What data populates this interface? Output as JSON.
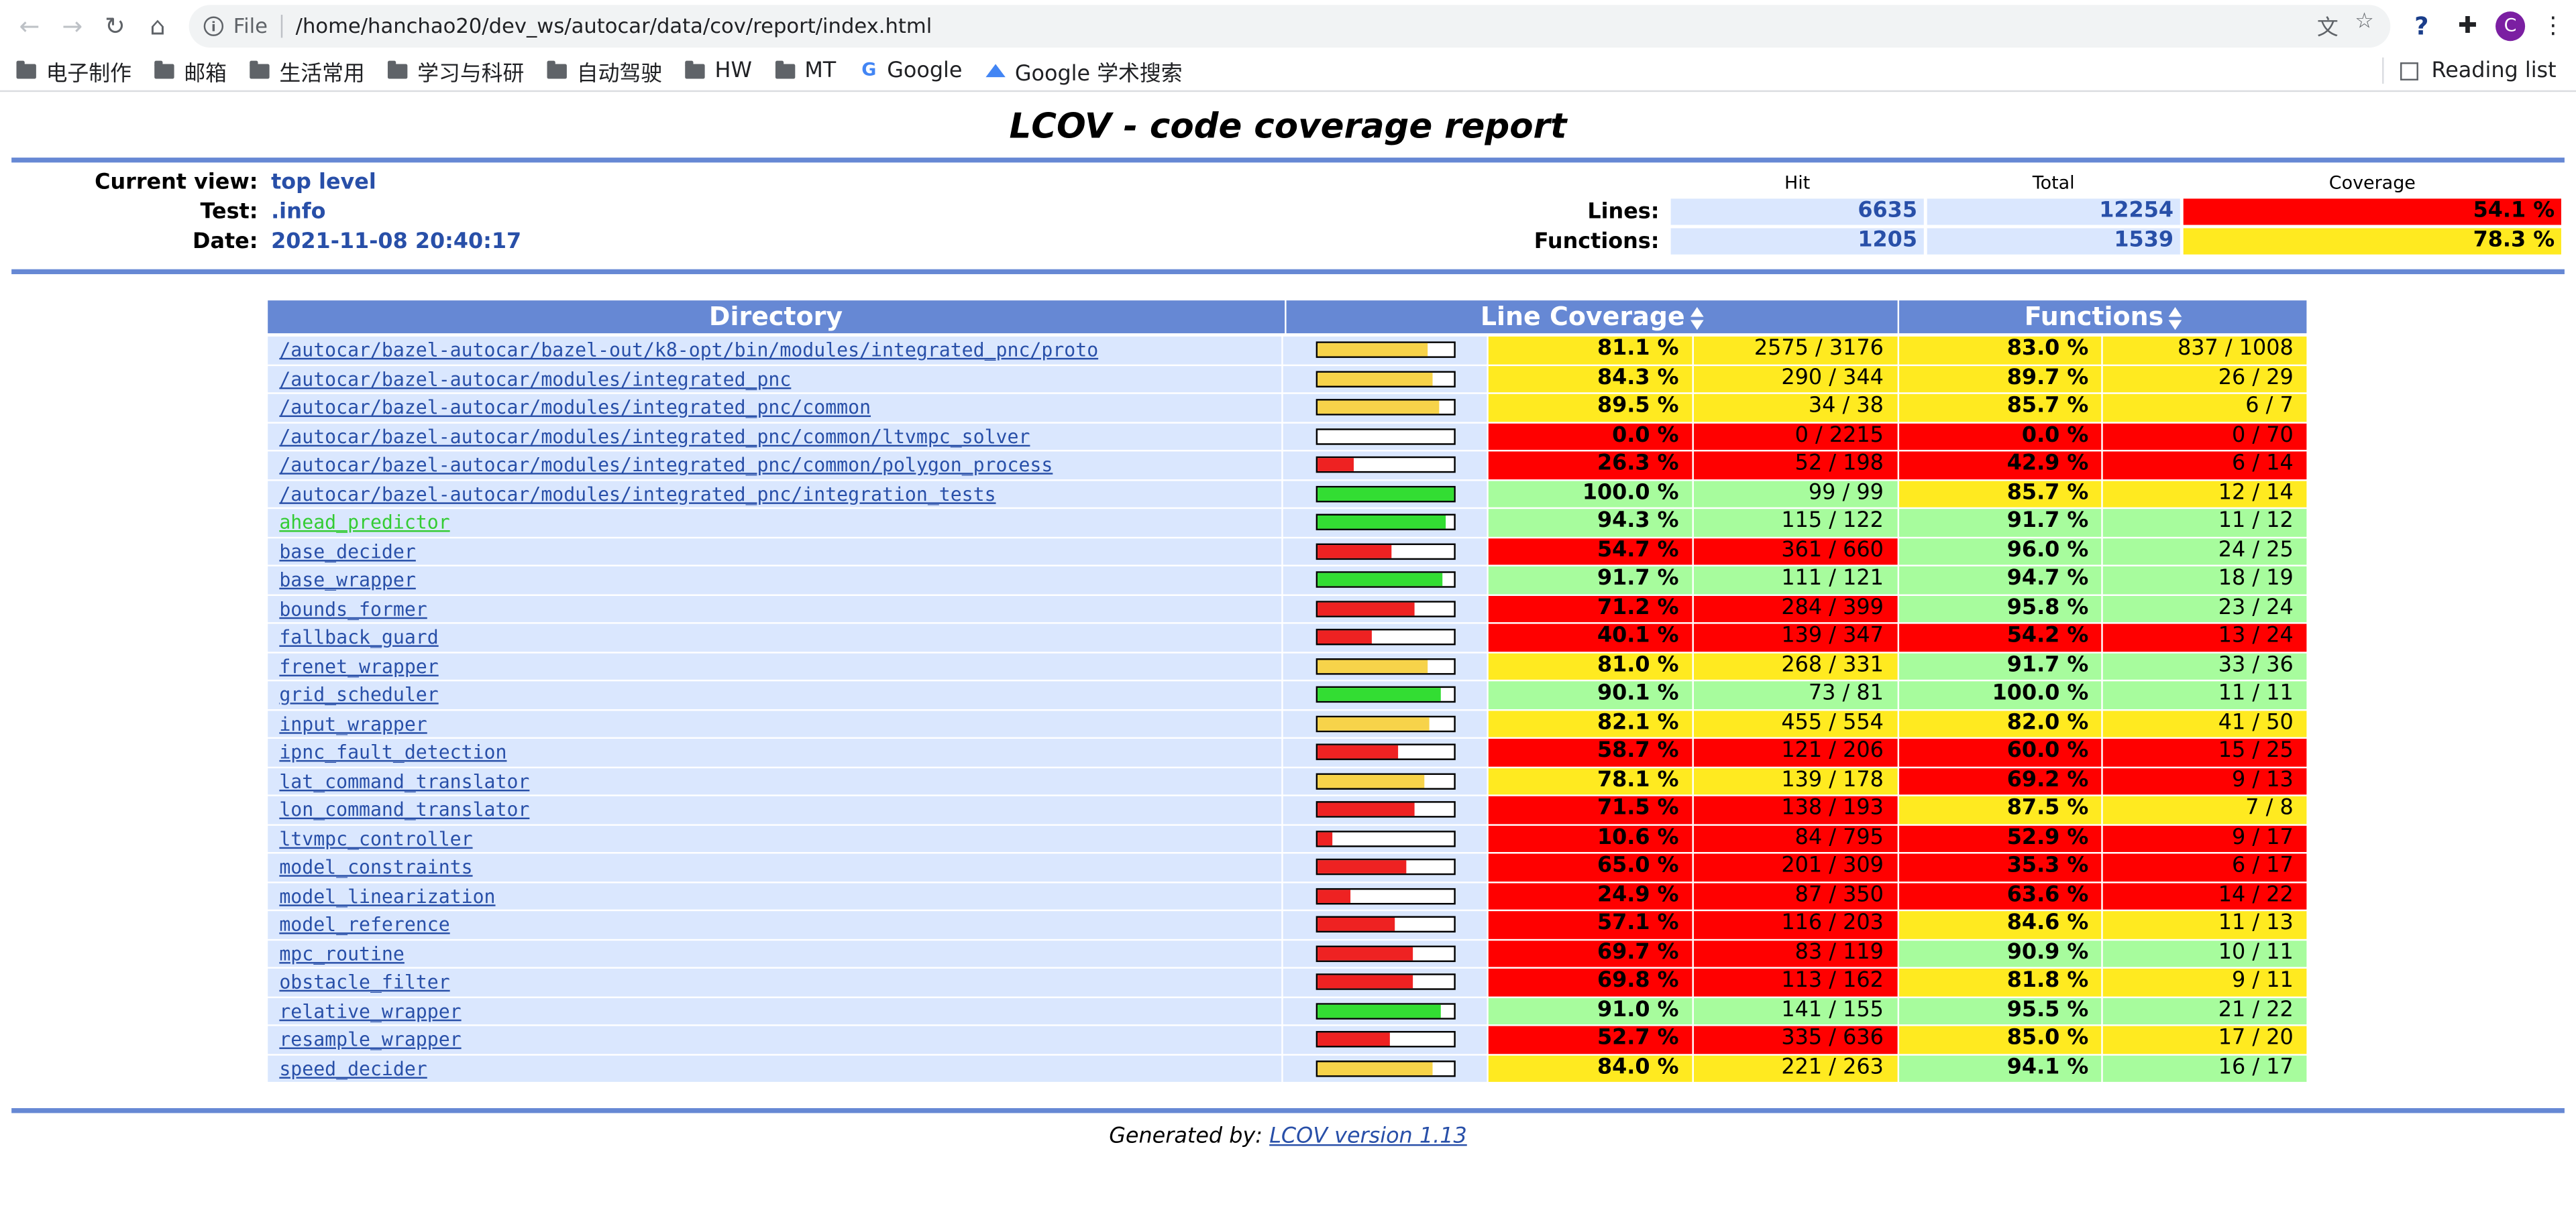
{
  "browser": {
    "scheme": "File",
    "url": "/home/hanchao20/dev_ws/autocar/data/cov/report/index.html",
    "avatar_letter": "C",
    "bookmarks": [
      "电子制作",
      "邮箱",
      "生活常用",
      "学习与科研",
      "自动驾驶",
      "HW",
      "MT"
    ],
    "bookmark_google": "Google",
    "bookmark_scholar": "Google 学术搜索",
    "reading_list": "Reading list"
  },
  "report": {
    "title": "LCOV - code coverage report",
    "current_view_label": "Current view:",
    "current_view": "top level",
    "test_label": "Test:",
    "test": ".info",
    "date_label": "Date:",
    "date": "2021-11-08 20:40:17",
    "col_hit": "Hit",
    "col_total": "Total",
    "col_coverage": "Coverage",
    "lines_label": "Lines:",
    "lines_hit": "6635",
    "lines_total": "12254",
    "lines_cov": "54.1 %",
    "functions_label": "Functions:",
    "functions_hit": "1205",
    "functions_total": "1539",
    "functions_cov": "78.3 %",
    "th_directory": "Directory",
    "th_line_cov": "Line Coverage",
    "th_functions": "Functions",
    "footer_prefix": "Generated by:",
    "footer_link": "LCOV version 1.13"
  },
  "colors": {
    "hi": "#a7fc9d",
    "med": "#ffea20",
    "lo": "#ff0000",
    "bar_hi": "#33dd33",
    "bar_med": "#f7d34a",
    "bar_lo": "#ee2222"
  },
  "rows": [
    {
      "dir": "/autocar/bazel-autocar/bazel-out/k8-opt/bin/modules/integrated_pnc/proto",
      "line_pct": "81.1 %",
      "line_frac": "2575 / 3176",
      "fn_pct": "83.0 %",
      "fn_frac": "837 / 1008",
      "line_val": 81.1,
      "fn_val": 83.0
    },
    {
      "dir": "/autocar/bazel-autocar/modules/integrated_pnc",
      "line_pct": "84.3 %",
      "line_frac": "290 / 344",
      "fn_pct": "89.7 %",
      "fn_frac": "26 / 29",
      "line_val": 84.3,
      "fn_val": 89.7
    },
    {
      "dir": "/autocar/bazel-autocar/modules/integrated_pnc/common",
      "line_pct": "89.5 %",
      "line_frac": "34 / 38",
      "fn_pct": "85.7 %",
      "fn_frac": "6 / 7",
      "line_val": 89.5,
      "fn_val": 85.7
    },
    {
      "dir": "/autocar/bazel-autocar/modules/integrated_pnc/common/ltvmpc_solver",
      "line_pct": "0.0 %",
      "line_frac": "0 / 2215",
      "fn_pct": "0.0 %",
      "fn_frac": "0 / 70",
      "line_val": 0.0,
      "fn_val": 0.0
    },
    {
      "dir": "/autocar/bazel-autocar/modules/integrated_pnc/common/polygon_process",
      "line_pct": "26.3 %",
      "line_frac": "52 / 198",
      "fn_pct": "42.9 %",
      "fn_frac": "6 / 14",
      "line_val": 26.3,
      "fn_val": 42.9
    },
    {
      "dir": "/autocar/bazel-autocar/modules/integrated_pnc/integration_tests",
      "line_pct": "100.0 %",
      "line_frac": "99 / 99",
      "fn_pct": "85.7 %",
      "fn_frac": "12 / 14",
      "line_val": 100.0,
      "fn_val": 85.7
    },
    {
      "dir": "ahead_predictor",
      "line_pct": "94.3 %",
      "line_frac": "115 / 122",
      "fn_pct": "91.7 %",
      "fn_frac": "11 / 12",
      "line_val": 94.3,
      "fn_val": 91.7
    },
    {
      "dir": "base_decider",
      "line_pct": "54.7 %",
      "line_frac": "361 / 660",
      "fn_pct": "96.0 %",
      "fn_frac": "24 / 25",
      "line_val": 54.7,
      "fn_val": 96.0
    },
    {
      "dir": "base_wrapper",
      "line_pct": "91.7 %",
      "line_frac": "111 / 121",
      "fn_pct": "94.7 %",
      "fn_frac": "18 / 19",
      "line_val": 91.7,
      "fn_val": 94.7
    },
    {
      "dir": "bounds_former",
      "line_pct": "71.2 %",
      "line_frac": "284 / 399",
      "fn_pct": "95.8 %",
      "fn_frac": "23 / 24",
      "line_val": 71.2,
      "fn_val": 95.8
    },
    {
      "dir": "fallback_guard",
      "line_pct": "40.1 %",
      "line_frac": "139 / 347",
      "fn_pct": "54.2 %",
      "fn_frac": "13 / 24",
      "line_val": 40.1,
      "fn_val": 54.2
    },
    {
      "dir": "frenet_wrapper",
      "line_pct": "81.0 %",
      "line_frac": "268 / 331",
      "fn_pct": "91.7 %",
      "fn_frac": "33 / 36",
      "line_val": 81.0,
      "fn_val": 91.7
    },
    {
      "dir": "grid_scheduler",
      "line_pct": "90.1 %",
      "line_frac": "73 / 81",
      "fn_pct": "100.0 %",
      "fn_frac": "11 / 11",
      "line_val": 90.1,
      "fn_val": 100.0
    },
    {
      "dir": "input_wrapper",
      "line_pct": "82.1 %",
      "line_frac": "455 / 554",
      "fn_pct": "82.0 %",
      "fn_frac": "41 / 50",
      "line_val": 82.1,
      "fn_val": 82.0
    },
    {
      "dir": "ipnc_fault_detection",
      "line_pct": "58.7 %",
      "line_frac": "121 / 206",
      "fn_pct": "60.0 %",
      "fn_frac": "15 / 25",
      "line_val": 58.7,
      "fn_val": 60.0
    },
    {
      "dir": "lat_command_translator",
      "line_pct": "78.1 %",
      "line_frac": "139 / 178",
      "fn_pct": "69.2 %",
      "fn_frac": "9 / 13",
      "line_val": 78.1,
      "fn_val": 69.2
    },
    {
      "dir": "lon_command_translator",
      "line_pct": "71.5 %",
      "line_frac": "138 / 193",
      "fn_pct": "87.5 %",
      "fn_frac": "7 / 8",
      "line_val": 71.5,
      "fn_val": 87.5
    },
    {
      "dir": "ltvmpc_controller",
      "line_pct": "10.6 %",
      "line_frac": "84 / 795",
      "fn_pct": "52.9 %",
      "fn_frac": "9 / 17",
      "line_val": 10.6,
      "fn_val": 52.9
    },
    {
      "dir": "model_constraints",
      "line_pct": "65.0 %",
      "line_frac": "201 / 309",
      "fn_pct": "35.3 %",
      "fn_frac": "6 / 17",
      "line_val": 65.0,
      "fn_val": 35.3
    },
    {
      "dir": "model_linearization",
      "line_pct": "24.9 %",
      "line_frac": "87 / 350",
      "fn_pct": "63.6 %",
      "fn_frac": "14 / 22",
      "line_val": 24.9,
      "fn_val": 63.6
    },
    {
      "dir": "model_reference",
      "line_pct": "57.1 %",
      "line_frac": "116 / 203",
      "fn_pct": "84.6 %",
      "fn_frac": "11 / 13",
      "line_val": 57.1,
      "fn_val": 84.6
    },
    {
      "dir": "mpc_routine",
      "line_pct": "69.7 %",
      "line_frac": "83 / 119",
      "fn_pct": "90.9 %",
      "fn_frac": "10 / 11",
      "line_val": 69.7,
      "fn_val": 90.9
    },
    {
      "dir": "obstacle_filter",
      "line_pct": "69.8 %",
      "line_frac": "113 / 162",
      "fn_pct": "81.8 %",
      "fn_frac": "9 / 11",
      "line_val": 69.8,
      "fn_val": 81.8
    },
    {
      "dir": "relative_wrapper",
      "line_pct": "91.0 %",
      "line_frac": "141 / 155",
      "fn_pct": "95.5 %",
      "fn_frac": "21 / 22",
      "line_val": 91.0,
      "fn_val": 95.5
    },
    {
      "dir": "resample_wrapper",
      "line_pct": "52.7 %",
      "line_frac": "335 / 636",
      "fn_pct": "85.0 %",
      "fn_frac": "17 / 20",
      "line_val": 52.7,
      "fn_val": 85.0
    },
    {
      "dir": "speed_decider",
      "line_pct": "84.0 %",
      "line_frac": "221 / 263",
      "fn_pct": "94.1 %",
      "fn_frac": "16 / 17",
      "line_val": 84.0,
      "fn_val": 94.1
    }
  ]
}
